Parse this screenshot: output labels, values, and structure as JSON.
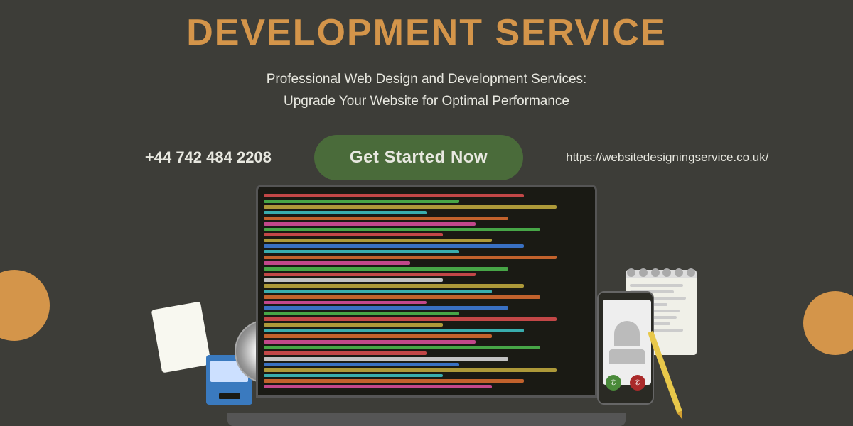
{
  "title": {
    "line1": "DEVELOPMENT SERVICE",
    "subtitle": "Professional Web Design and Development Services:\nUpgrade Your Website for Optimal Performance"
  },
  "cta": {
    "phone": "+44 742 484 2208",
    "button_label": "Get Started Now",
    "url": "https://websitedesigningservice.co.uk/"
  },
  "colors": {
    "background": "#3d3d38",
    "title_color": "#d4954a",
    "circle_color": "#d4954a",
    "button_bg": "#4a6b3a",
    "text_color": "#e8e8e0"
  }
}
